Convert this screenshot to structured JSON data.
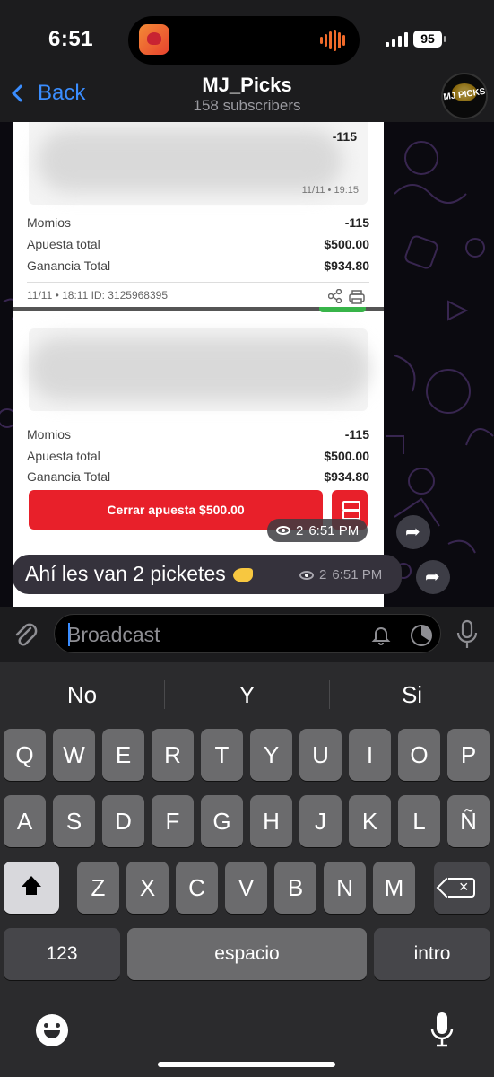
{
  "status": {
    "time": "6:51",
    "battery": "95"
  },
  "header": {
    "back_label": "Back",
    "title": "MJ_Picks",
    "subtitle": "158 subscribers",
    "avatar_text": "MJ PICKS"
  },
  "chat": {
    "photo": {
      "ticket1": {
        "top_odds": "-115",
        "ticket_time": "11/11 • 19:15",
        "rows": [
          {
            "label": "Momios",
            "value": "-115"
          },
          {
            "label": "Apuesta total",
            "value": "$500.00"
          },
          {
            "label": "Ganancia Total",
            "value": "$934.80"
          }
        ],
        "meta": "11/11 • 18:11   ID: 3125968395"
      },
      "ticket2": {
        "rows": [
          {
            "label": "Momios",
            "value": "-115"
          },
          {
            "label": "Apuesta total",
            "value": "$500.00"
          },
          {
            "label": "Ganancia Total",
            "value": "$934.80"
          }
        ],
        "button": "Cerrar apuesta $500.00"
      },
      "views": "2",
      "time": "6:51 PM"
    },
    "message": {
      "text": "Ahí les van 2 picketes",
      "views": "2",
      "time": "6:51 PM"
    }
  },
  "input": {
    "placeholder": "Broadcast"
  },
  "keyboard": {
    "suggestions": [
      "No",
      "Y",
      "Si"
    ],
    "row1": [
      "Q",
      "W",
      "E",
      "R",
      "T",
      "Y",
      "U",
      "I",
      "O",
      "P"
    ],
    "row2": [
      "A",
      "S",
      "D",
      "F",
      "G",
      "H",
      "J",
      "K",
      "L",
      "Ñ"
    ],
    "row3": [
      "Z",
      "X",
      "C",
      "V",
      "B",
      "N",
      "M"
    ],
    "numbers_label": "123",
    "space_label": "espacio",
    "return_label": "intro"
  },
  "colors": {
    "accent": "#3a8dff",
    "bet_red": "#e8202a",
    "bubble": "#35323c"
  }
}
